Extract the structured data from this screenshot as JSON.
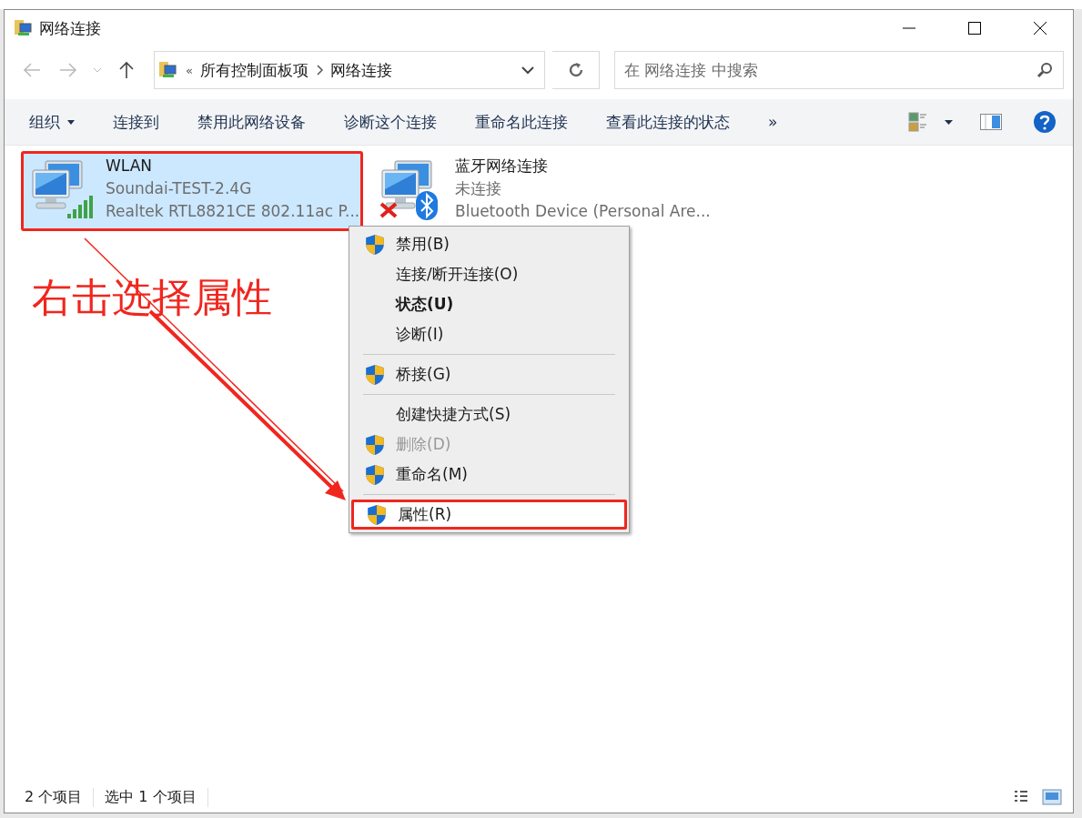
{
  "window": {
    "title": "网络连接"
  },
  "address": {
    "overflow": "«",
    "path": [
      "所有控制面板项",
      "网络连接"
    ]
  },
  "search": {
    "placeholder": "在 网络连接 中搜索"
  },
  "toolbar": [
    {
      "label": "组织",
      "dropdown": true
    },
    {
      "label": "连接到",
      "dropdown": false
    },
    {
      "label": "禁用此网络设备",
      "dropdown": false
    },
    {
      "label": "诊断这个连接",
      "dropdown": false
    },
    {
      "label": "重命名此连接",
      "dropdown": false
    },
    {
      "label": "查看此连接的状态",
      "dropdown": false
    },
    {
      "label": "»",
      "dropdown": false
    }
  ],
  "items": [
    {
      "kind": "wifi",
      "name": "WLAN",
      "status": "Soundai-TEST-2.4G",
      "device": "Realtek RTL8821CE 802.11ac P...",
      "selected": true,
      "annotated": true
    },
    {
      "kind": "bluetooth",
      "name": "蓝牙网络连接",
      "status": "未连接",
      "device": "Bluetooth Device (Personal Are...",
      "selected": false,
      "annotated": false
    }
  ],
  "context_menu": [
    {
      "kind": "item",
      "label": "禁用(B)",
      "shield": true,
      "bold": false,
      "disabled": false,
      "annotated": false
    },
    {
      "kind": "item",
      "label": "连接/断开连接(O)",
      "shield": false,
      "bold": false,
      "disabled": false,
      "annotated": false
    },
    {
      "kind": "item",
      "label": "状态(U)",
      "shield": false,
      "bold": true,
      "disabled": false,
      "annotated": false
    },
    {
      "kind": "item",
      "label": "诊断(I)",
      "shield": false,
      "bold": false,
      "disabled": false,
      "annotated": false
    },
    {
      "kind": "separator"
    },
    {
      "kind": "item",
      "label": "桥接(G)",
      "shield": true,
      "bold": false,
      "disabled": false,
      "annotated": false
    },
    {
      "kind": "separator"
    },
    {
      "kind": "item",
      "label": "创建快捷方式(S)",
      "shield": false,
      "bold": false,
      "disabled": false,
      "annotated": false
    },
    {
      "kind": "item",
      "label": "删除(D)",
      "shield": true,
      "bold": false,
      "disabled": true,
      "annotated": false
    },
    {
      "kind": "item",
      "label": "重命名(M)",
      "shield": true,
      "bold": false,
      "disabled": false,
      "annotated": false
    },
    {
      "kind": "separator"
    },
    {
      "kind": "item",
      "label": "属性(R)",
      "shield": true,
      "bold": false,
      "disabled": false,
      "annotated": true
    }
  ],
  "annotation": {
    "text": "右击选择属性"
  },
  "status_bar": [
    "2 个项目",
    "选中 1 个项目"
  ]
}
